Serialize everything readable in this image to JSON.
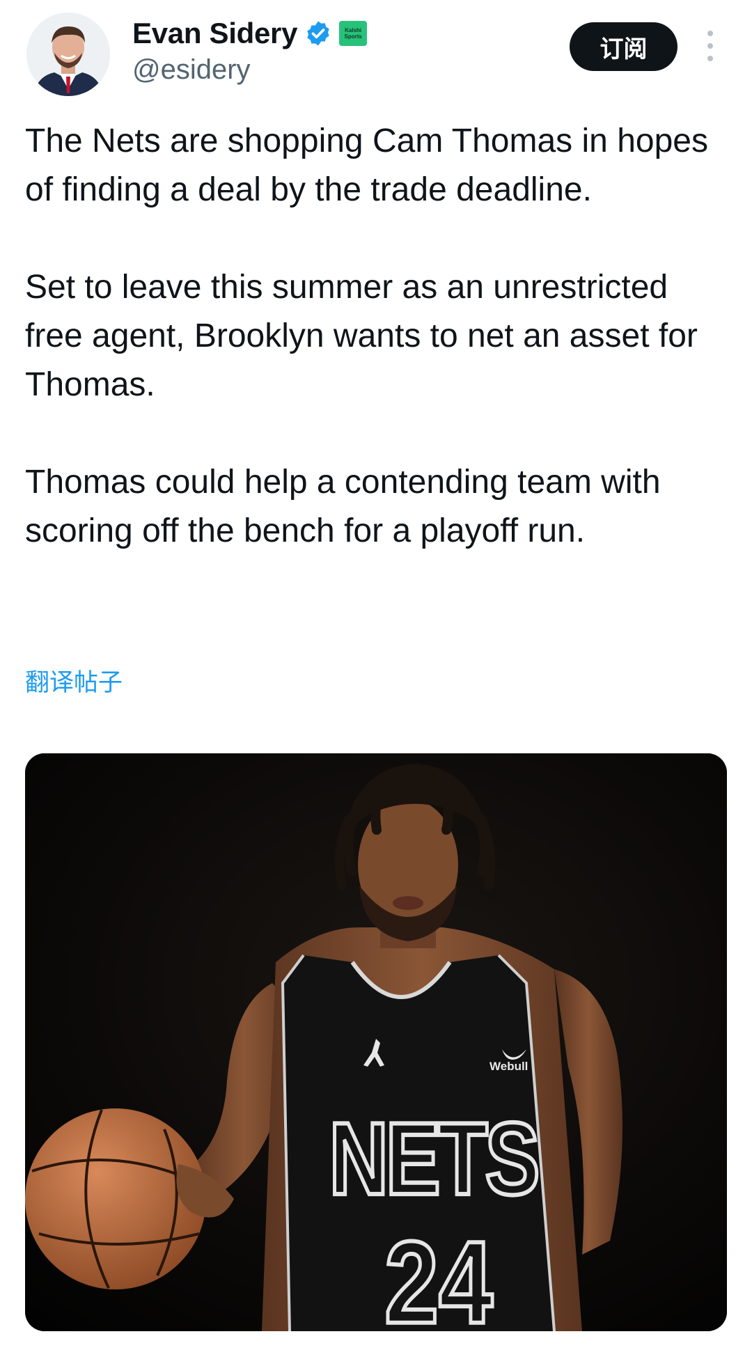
{
  "author": {
    "display_name": "Evan Sidery",
    "handle": "@esidery",
    "verified_icon": "verified-check-icon",
    "affiliate_badge": {
      "line1": "Kalshi",
      "line2": "Sports"
    },
    "avatar": "avatar-portrait"
  },
  "actions": {
    "subscribe_label": "订阅",
    "more_icon": "vertical-ellipsis-icon"
  },
  "tweet": {
    "paragraphs": [
      "The Nets are shopping Cam Thomas in hopes of finding a deal by the trade deadline.",
      "Set to leave this summer as an unrestricted free agent, Brooklyn wants to net an asset for Thomas.",
      "Thomas could help a contending team with scoring off the bench for a playoff run."
    ],
    "translate_label": "翻译帖子"
  },
  "media": {
    "description_icon": "photo-basketball-player",
    "jersey_wordmark": "NETS",
    "jersey_number": "24",
    "sponsor": "Webull"
  },
  "colors": {
    "accent": "#1d9bf0",
    "subscribe_bg": "#0f1419",
    "badge_green": "#27c27a"
  }
}
